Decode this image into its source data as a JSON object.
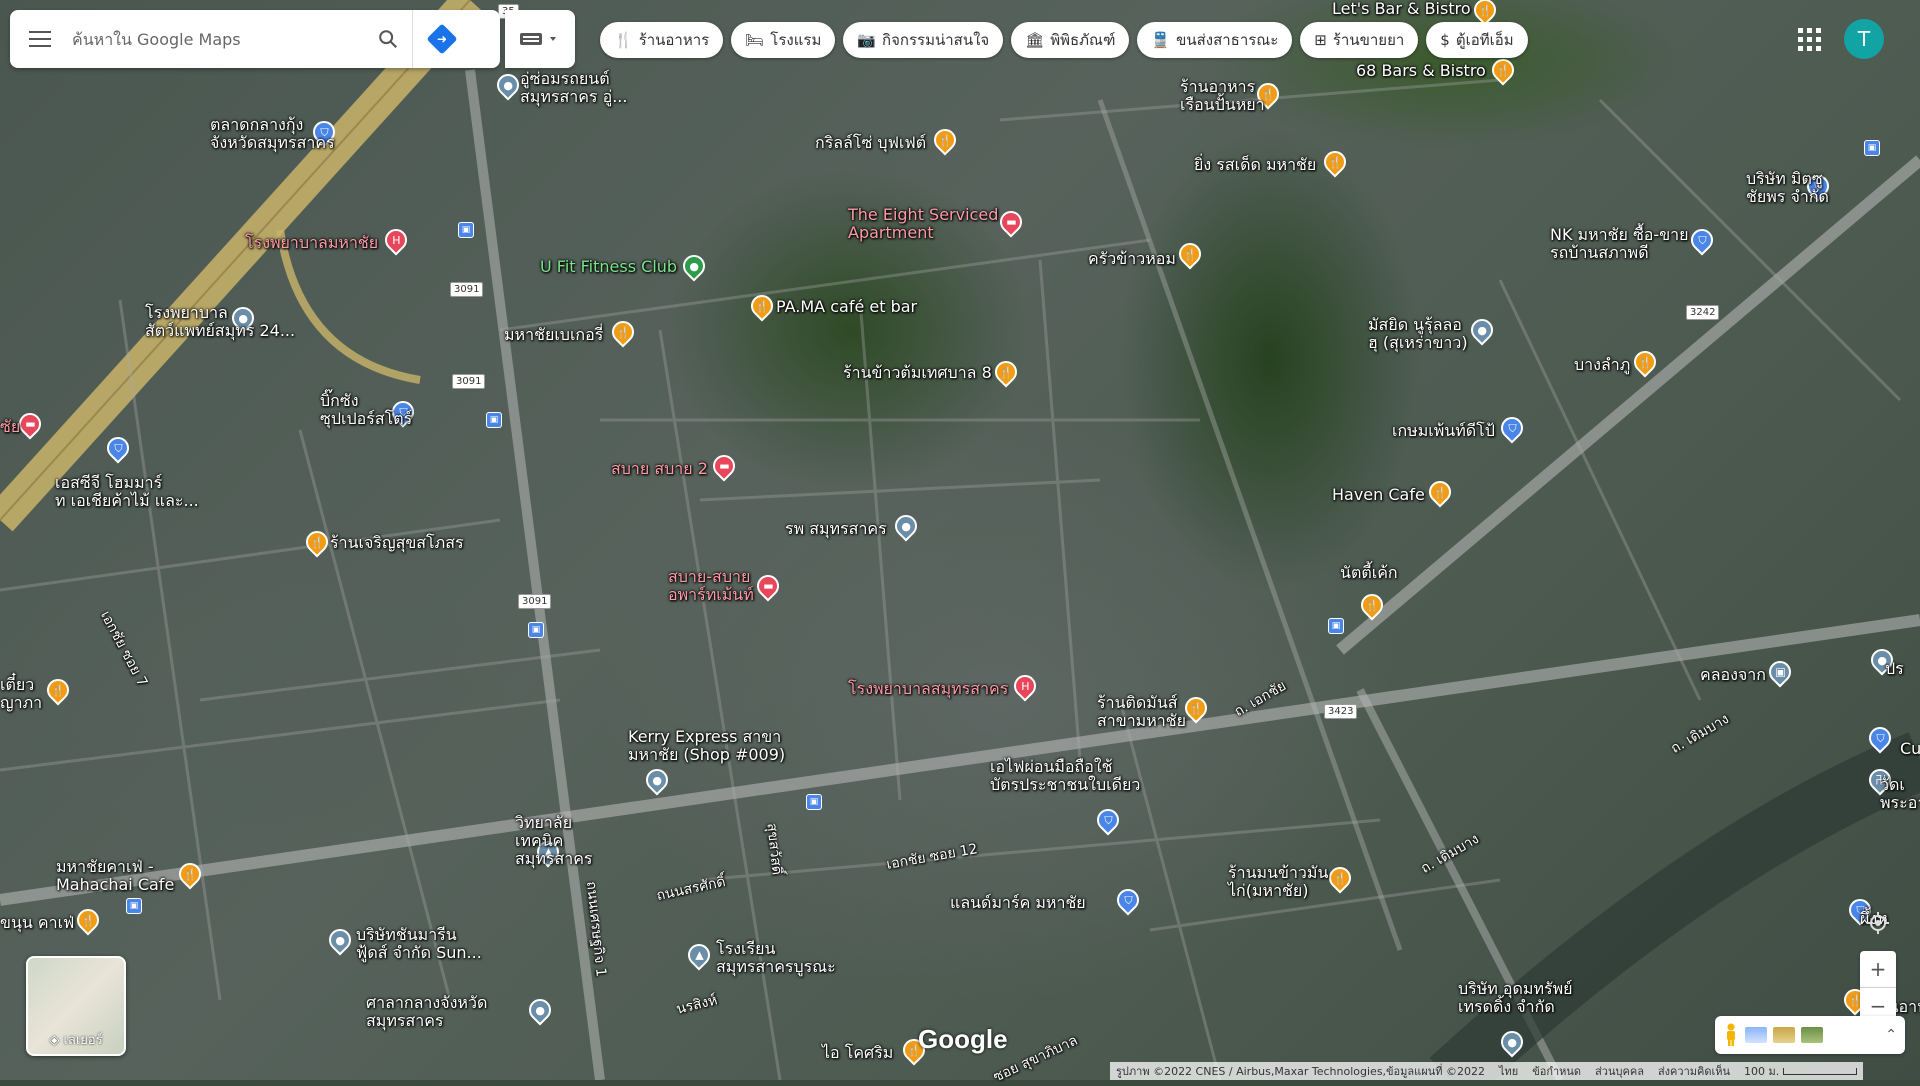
{
  "search": {
    "placeholder": "ค้นหาใน Google Maps"
  },
  "chips": [
    {
      "icon": "restaurant-icon",
      "label": "ร้านอาหาร"
    },
    {
      "icon": "hotel-icon",
      "label": "โรงแรม"
    },
    {
      "icon": "camera-icon",
      "label": "กิจกรรมน่าสนใจ"
    },
    {
      "icon": "museum-icon",
      "label": "พิพิธภัณฑ์"
    },
    {
      "icon": "transit-icon",
      "label": "ขนส่งสาธารณะ"
    },
    {
      "icon": "pharmacy-icon",
      "label": "ร้านขายยา"
    },
    {
      "icon": "atm-icon",
      "label": "ตู้เอทีเอ็ม"
    }
  ],
  "avatar": {
    "initial": "T",
    "color": "#12a4a4"
  },
  "places": [
    {
      "name": "อู่ซ่อมรถยนต์\nสมุทรสาคร อู่...",
      "type": "place"
    },
    {
      "name": "ตลาดกลางกุ้ง\nจังหวัดสมุทรสาคร",
      "type": "shop"
    },
    {
      "name": "โรงพยาบาลมหาชัย",
      "type": "hospital"
    },
    {
      "name": "โรงพยาบาล\nสัตว์แพทย์สมุทร 24...",
      "type": "place"
    },
    {
      "name": "บิ๊กซัง\nซุปเปอร์สโตร์",
      "type": "shop"
    },
    {
      "name": "เอสซีจี โฮมมาร์\nท เอเชียค้าไม้ และ...",
      "type": "shop"
    },
    {
      "name": "ร้านเจริญสุขสโภสร",
      "type": "food"
    },
    {
      "name": "กริลล์โซ่ บุฟเฟต์",
      "type": "food"
    },
    {
      "name": "The Eight Serviced\nApartment",
      "type": "hotel"
    },
    {
      "name": "U Fit Fitness Club",
      "type": "gym"
    },
    {
      "name": "PA.MA café et bar",
      "type": "food"
    },
    {
      "name": "มหาชัยเบเกอรี่",
      "type": "food"
    },
    {
      "name": "ร้านข้าวต้มเทศบาล 8",
      "type": "food"
    },
    {
      "name": "ครัวข้าวหอม",
      "type": "food"
    },
    {
      "name": "สบาย สบาย 2",
      "type": "hotel"
    },
    {
      "name": "รพ สมุทรสาคร",
      "type": "place"
    },
    {
      "name": "สบาย-สบาย\nอพาร์ทเม้นท์",
      "type": "hotel"
    },
    {
      "name": "โรงพยาบาลสมุทรสาคร",
      "type": "hospital"
    },
    {
      "name": "Kerry Express สาขา\nมหาชัย (Shop #009)",
      "type": "place"
    },
    {
      "name": "วิทยาลัย\nเทคนิค\nสมุทรสาคร",
      "type": "edu"
    },
    {
      "name": "เอไฟผ่อนมือถือใช้\nบัตรประชาชนใบเดียว",
      "type": "shop"
    },
    {
      "name": "ร้านติดมันส์\nสาขามหาชัย",
      "type": "food"
    },
    {
      "name": "แลนด์มาร์ค มหาชัย",
      "type": "shop"
    },
    {
      "name": "ร้านมนข้าวมัน\nไก่(มหาชัย)",
      "type": "food"
    },
    {
      "name": "มหาชัยคาเฟ่ -\nMahachai Cafe",
      "type": "food"
    },
    {
      "name": "ขนุน คาเฟ่",
      "type": "food"
    },
    {
      "name": "บริษัทชันมารีน\nฟู้ดส์ จำกัด Sun...",
      "type": "place"
    },
    {
      "name": "ศาลากลางจังหวัด\nสมุทรสาคร",
      "type": "place"
    },
    {
      "name": "โรงเรียน\nสมุทรสาครบูรณะ",
      "type": "edu"
    },
    {
      "name": "ไอ โคศริม",
      "type": "food"
    },
    {
      "name": "Let's Bar & Bistro",
      "type": "food"
    },
    {
      "name": "68 Bars & Bistro",
      "type": "food"
    },
    {
      "name": "ร้านอาหาร\nเรือนปั้นหยา",
      "type": "food"
    },
    {
      "name": "ยิ่ง รสเด็ด มหาชัย",
      "type": "food"
    },
    {
      "name": "บริษัท มิตซู\nชัยพร จำกัด",
      "type": "shop"
    },
    {
      "name": "NK มหาชัย ซื้อ-ขาย\nรถบ้านสภาพดี",
      "type": "shop"
    },
    {
      "name": "มัสยิด นูรุ้ลลอ\nฮุ (สุเหร่าขาว)",
      "type": "place"
    },
    {
      "name": "บางลำภู",
      "type": "food"
    },
    {
      "name": "เกษมเพ้นท์ดีโป้",
      "type": "shop"
    },
    {
      "name": "Haven Cafe",
      "type": "food"
    },
    {
      "name": "นัตตี้เค้ก",
      "type": "food"
    },
    {
      "name": "คลองจาก",
      "type": "transit"
    },
    {
      "name": "บริษัท อุดมทรัพย์\nเทรดดิ้ง จำกัด",
      "type": "place"
    },
    {
      "name": "เตี๋ยว\nญาภา",
      "type": "food"
    },
    {
      "name": "ร้านอาหาร",
      "type": "food"
    },
    {
      "name": "ผึ้งห",
      "type": "shop"
    },
    {
      "name": "วัดเ\nพระอาร",
      "type": "temple"
    },
    {
      "name": "Cu",
      "type": "shop"
    },
    {
      "name": "ปร",
      "type": "place"
    },
    {
      "name": "ซัย",
      "type": "hotel"
    }
  ],
  "roads": [
    "เอกชัย ซอย 7",
    "ถ. เอกชัย",
    "ถ. เดิมบาง",
    "ถ. เดิมบาง",
    "เอกชัย ซอย 12",
    "ถนนสรศักดิ์",
    "ถนนเศรษฐกิจ 1",
    "สุขสวัสดิ์",
    "นรสิงห์",
    "ซอย สุขาภิบาล"
  ],
  "shields": [
    "35",
    "3091",
    "3091",
    "3091",
    "3242",
    "3423"
  ],
  "controls": {
    "layers_label": "เลเยอร์",
    "zoom_in": "+",
    "zoom_out": "−"
  },
  "footer": {
    "attribution": "รูปภาพ ©2022 CNES / Airbus,Maxar Technologies,ข้อมูลแผนที่ ©2022",
    "links": [
      "ไทย",
      "ข้อกำหนด",
      "ส่วนบุคคล",
      "ส่งความคิดเห็น"
    ],
    "scale": "100 ม."
  },
  "brand": "Google"
}
